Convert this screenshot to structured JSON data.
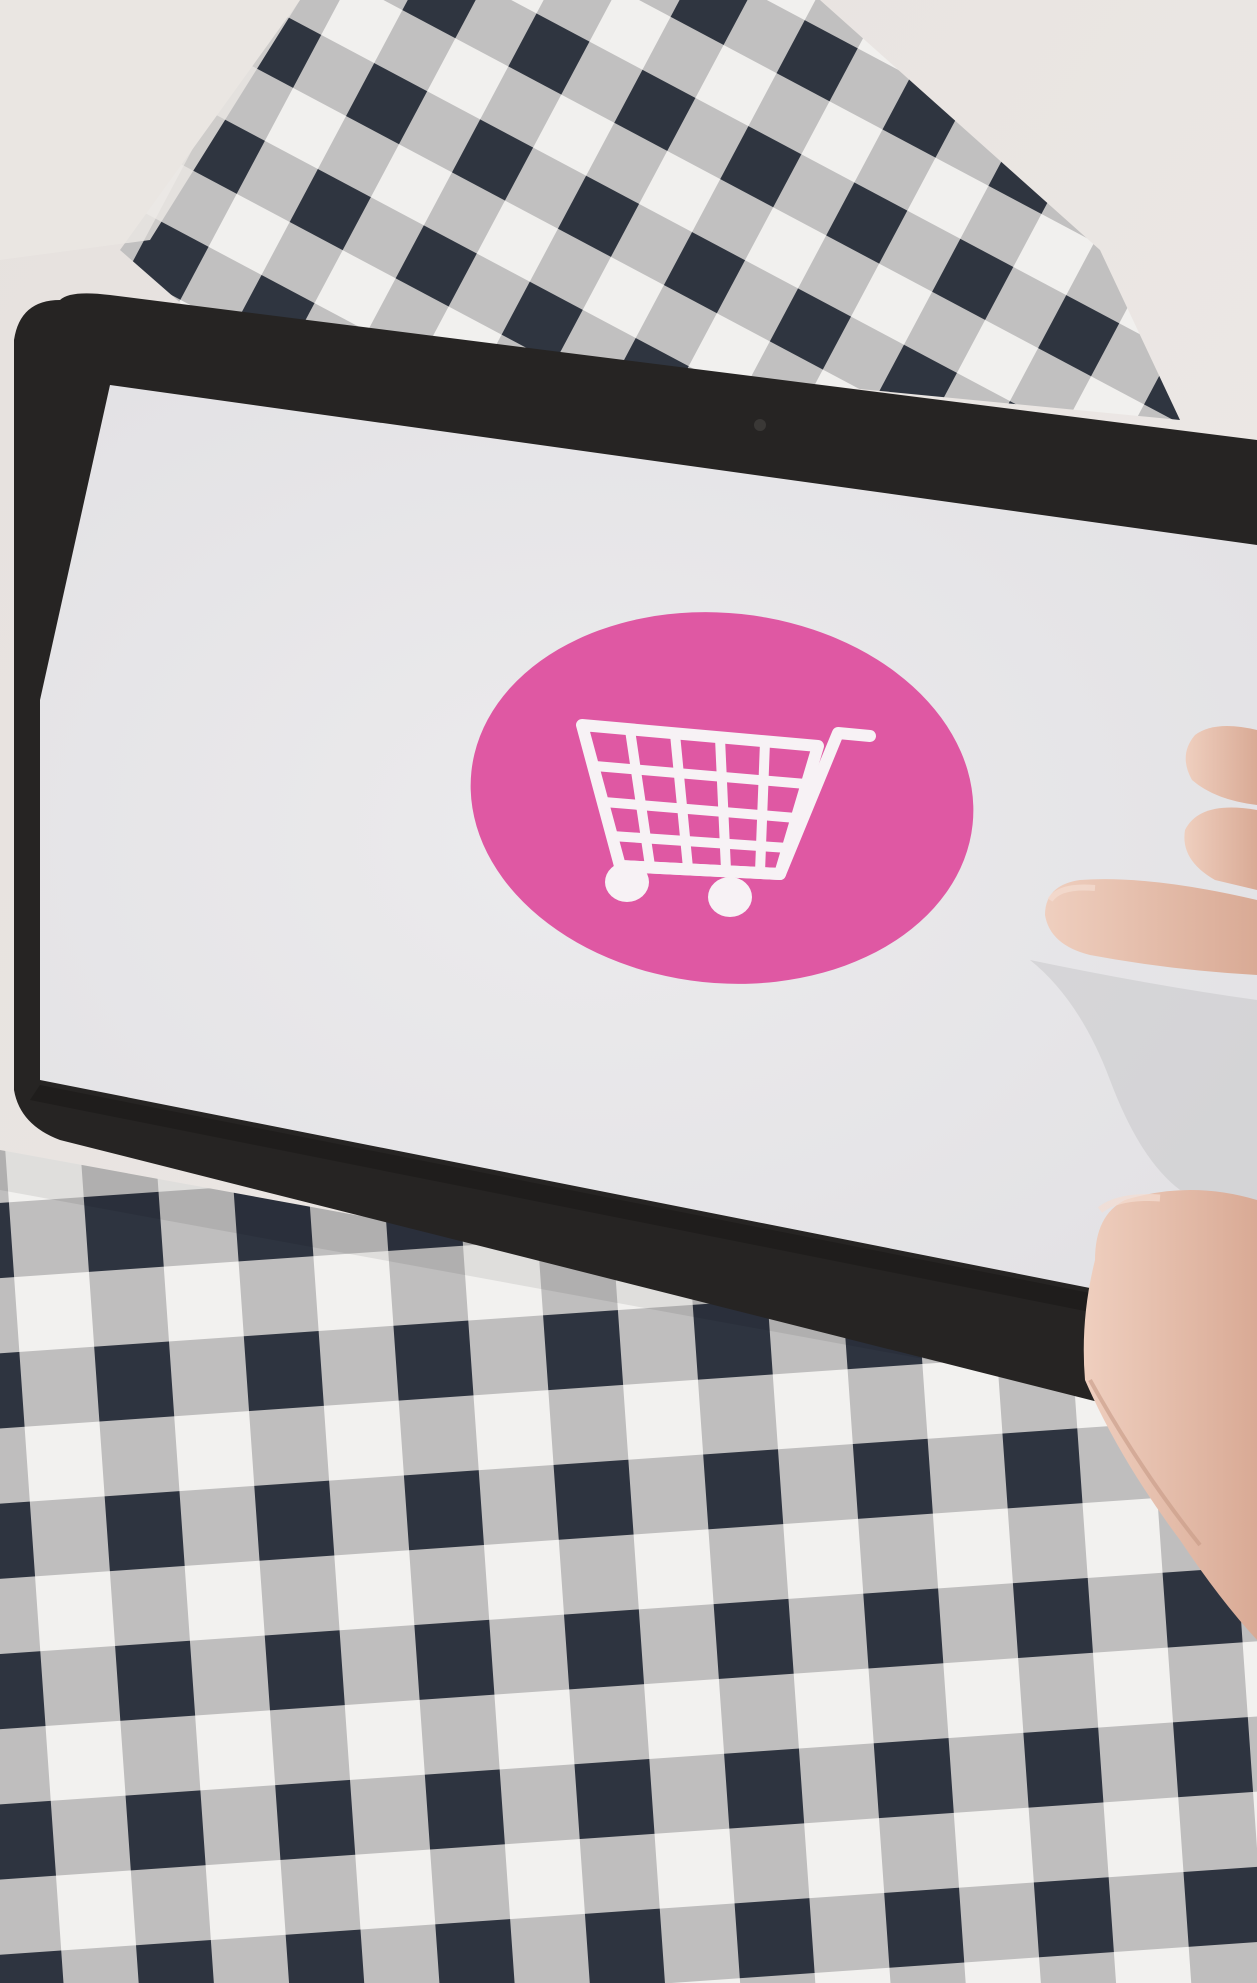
{
  "scene": {
    "subject": "tablet-with-shopping-cart-icon",
    "colors": {
      "bedsheet": "#ebe7e4",
      "plaid_light": "#f2f1ef",
      "plaid_gray": "#b9b8b9",
      "plaid_dark": "#2e3440",
      "tablet_bezel": "#262423",
      "screen": "#e8e7e9",
      "badge": "#df58a3",
      "cart_icon": "#f7f2f5",
      "skin": "#e7c3b1",
      "skin_shadow": "#c79a86"
    },
    "icons": [
      "shopping-cart-icon"
    ]
  }
}
